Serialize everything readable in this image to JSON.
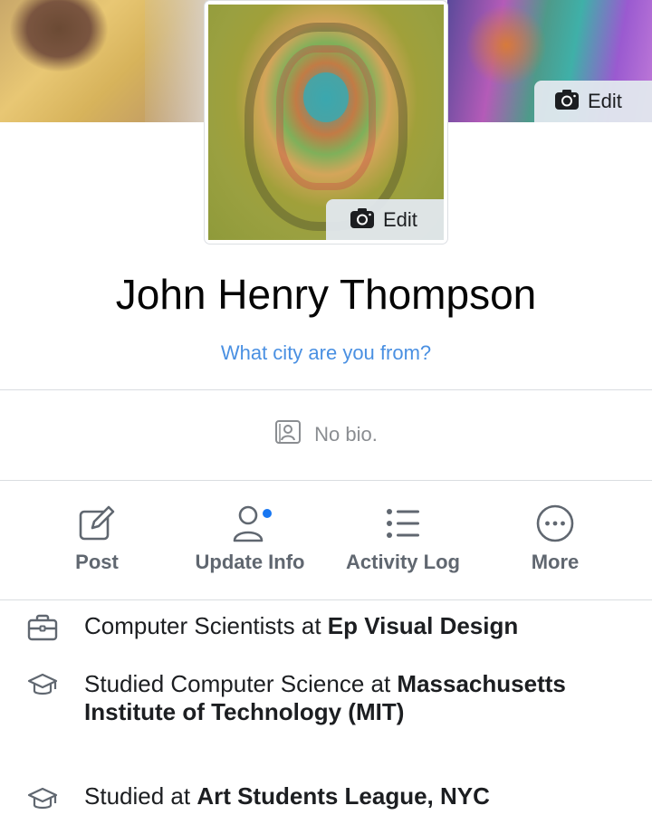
{
  "cover": {
    "edit_label": "Edit"
  },
  "profile_photo": {
    "edit_label": "Edit"
  },
  "profile": {
    "name": "John Henry Thompson",
    "city_prompt": "What city are you from?",
    "bio": "No bio."
  },
  "actions": [
    {
      "label": "Post",
      "icon": "edit-icon"
    },
    {
      "label": "Update Info",
      "icon": "person-icon",
      "has_notification": true
    },
    {
      "label": "Activity Log",
      "icon": "list-icon"
    },
    {
      "label": "More",
      "icon": "more-icon"
    }
  ],
  "intro": {
    "work": {
      "prefix": "Computer Scientists at ",
      "place": "Ep Visual Design"
    },
    "education1": {
      "prefix": "Studied Computer Science at ",
      "place": "Massachusetts Institute of Technology (MIT)"
    },
    "education2": {
      "prefix": "Studied at ",
      "place": "Art Students League, NYC"
    }
  },
  "colors": {
    "link": "#4a90e2",
    "notification": "#1877f2",
    "muted": "#8a8d91"
  }
}
